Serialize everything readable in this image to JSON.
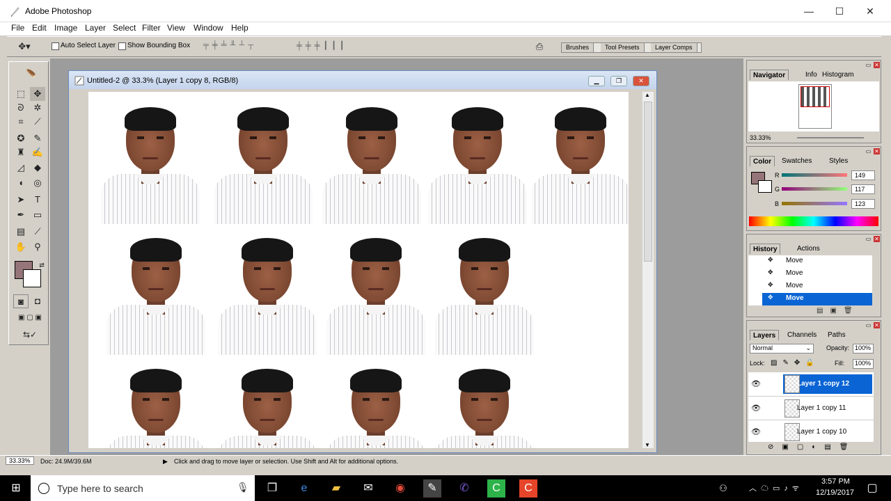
{
  "app": {
    "title": "Adobe Photoshop"
  },
  "window": {
    "min": "—",
    "max": "☐",
    "close": "✕"
  },
  "menu": [
    "File",
    "Edit",
    "Image",
    "Layer",
    "Select",
    "Filter",
    "View",
    "Window",
    "Help"
  ],
  "options": {
    "auto_select": "Auto Select Layer",
    "bounding_box": "Show Bounding Box",
    "wells": [
      "Brushes",
      "Tool Presets",
      "Layer Comps"
    ]
  },
  "doc": {
    "title": "Untitled-2 @ 33.3% (Layer 1 copy 8, RGB/8)"
  },
  "navigator": {
    "tabs": [
      "Navigator",
      "Info",
      "Histogram"
    ],
    "zoom": "33.33%"
  },
  "color": {
    "tabs": [
      "Color",
      "Swatches",
      "Styles"
    ],
    "r_label": "R",
    "g_label": "G",
    "b_label": "B",
    "r": "149",
    "g": "117",
    "b": "123",
    "fg": "#957579"
  },
  "history": {
    "tabs": [
      "History",
      "Actions"
    ],
    "items": [
      "Move",
      "Move",
      "Move",
      "Move"
    ]
  },
  "layers": {
    "tabs": [
      "Layers",
      "Channels",
      "Paths"
    ],
    "mode": "Normal",
    "opacity_label": "Opacity:",
    "opacity": "100%",
    "lock_label": "Lock:",
    "fill_label": "Fill:",
    "fill": "100%",
    "items": [
      "Layer 1 copy 12",
      "Layer 1 copy 11",
      "Layer 1 copy 10"
    ]
  },
  "status": {
    "zoom": "33.33%",
    "doc": "Doc: 24.9M/39.6M",
    "hint": "Click and drag to move layer or selection.  Use Shift and Alt for additional options."
  },
  "taskbar": {
    "search": "Type here to search",
    "time": "3:57 PM",
    "date": "12/19/2017"
  }
}
